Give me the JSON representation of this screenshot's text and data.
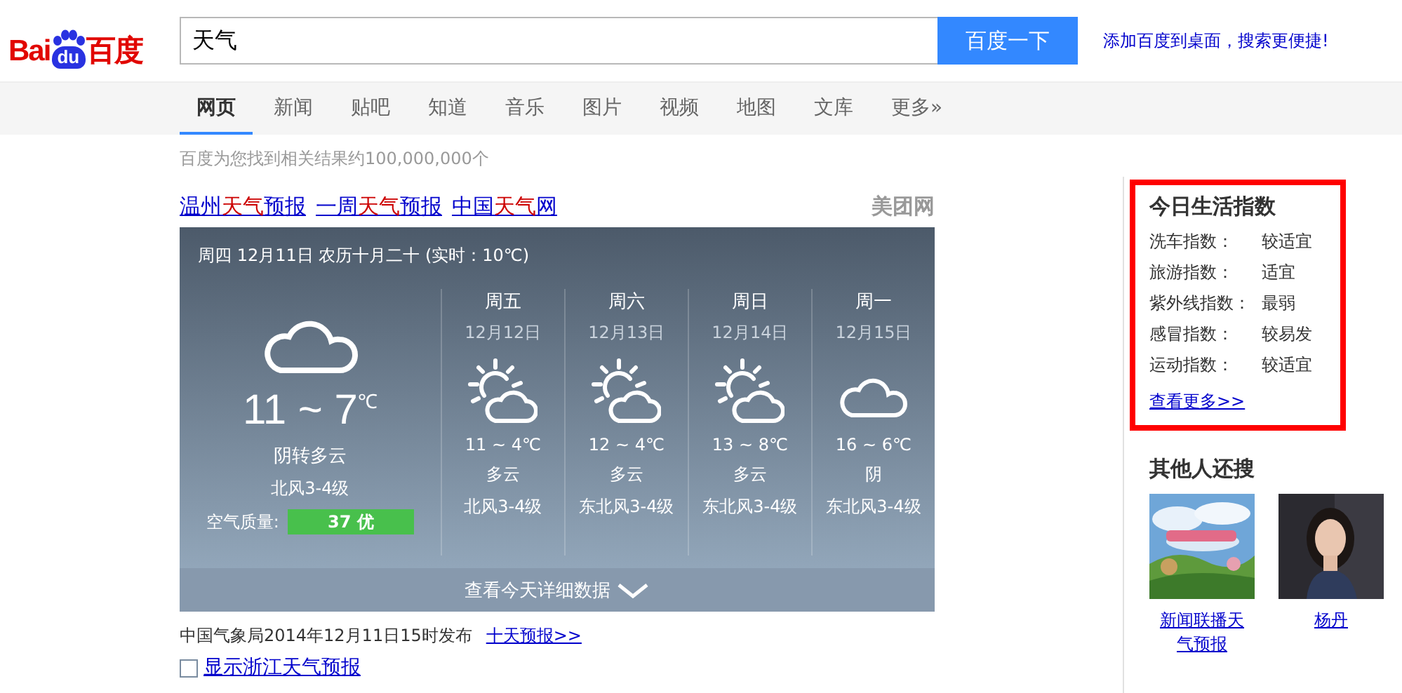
{
  "logo": {
    "left": "Bai",
    "mark": "du",
    "right": "百度"
  },
  "search": {
    "value": "天气",
    "button": "百度一下"
  },
  "promo_link": "添加百度到桌面，搜索更便捷!",
  "tabs": [
    {
      "label": "网页",
      "selected": true
    },
    {
      "label": "新闻",
      "selected": false
    },
    {
      "label": "贴吧",
      "selected": false
    },
    {
      "label": "知道",
      "selected": false
    },
    {
      "label": "音乐",
      "selected": false
    },
    {
      "label": "图片",
      "selected": false
    },
    {
      "label": "视频",
      "selected": false
    },
    {
      "label": "地图",
      "selected": false
    },
    {
      "label": "文库",
      "selected": false
    },
    {
      "label": "更多»",
      "selected": false
    }
  ],
  "result_count": "百度为您找到相关结果约100,000,000个",
  "result_title": [
    [
      {
        "text": "温州",
        "highlight": false
      },
      {
        "text": "天气",
        "highlight": true
      },
      {
        "text": "预报",
        "highlight": false
      }
    ],
    [
      {
        "text": "一周",
        "highlight": false
      },
      {
        "text": "天气",
        "highlight": true
      },
      {
        "text": "预报",
        "highlight": false
      }
    ],
    [
      {
        "text": "中国",
        "highlight": false
      },
      {
        "text": "天气",
        "highlight": true
      },
      {
        "text": "网",
        "highlight": false
      }
    ]
  ],
  "source_site": "美团网",
  "weather": {
    "header": "周四 12月11日 农历十月二十 (实时：10℃)",
    "today": {
      "kind": "cloudy",
      "temp": "11 ~ 7",
      "unit": "℃",
      "condition": "阴转多云",
      "wind": "北风3-4级",
      "air_label": "空气质量:",
      "air_value": "37 优"
    },
    "days": [
      {
        "day": "周五",
        "date": "12月12日",
        "kind": "partly_cloudy",
        "temp": "11 ~ 4℃",
        "condition": "多云",
        "wind": "北风3-4级"
      },
      {
        "day": "周六",
        "date": "12月13日",
        "kind": "partly_cloudy",
        "temp": "12 ~ 4℃",
        "condition": "多云",
        "wind": "东北风3-4级"
      },
      {
        "day": "周日",
        "date": "12月14日",
        "kind": "partly_cloudy",
        "temp": "13 ~ 8℃",
        "condition": "多云",
        "wind": "东北风3-4级"
      },
      {
        "day": "周一",
        "date": "12月15日",
        "kind": "cloudy",
        "temp": "16 ~ 6℃",
        "condition": "阴",
        "wind": "东北风3-4级"
      }
    ],
    "details_button": "查看今天详细数据"
  },
  "publish_note": "中国气象局2014年12月11日15时发布",
  "ten_day_link": "十天预报>>",
  "zhejiang_option": {
    "label": "显示浙江天气预报",
    "checked": false
  },
  "life_index": {
    "title": "今日生活指数",
    "rows": [
      {
        "label": "洗车指数：",
        "value": "较适宜"
      },
      {
        "label": "旅游指数：",
        "value": "适宜"
      },
      {
        "label": "紫外线指数：",
        "value": "最弱"
      },
      {
        "label": "感冒指数：",
        "value": "较易发"
      },
      {
        "label": "运动指数：",
        "value": "较适宜"
      }
    ],
    "more": "查看更多>>"
  },
  "related": {
    "title": "其他人还搜",
    "items": [
      {
        "kind": "picture",
        "caption": "新闻联播天气预报"
      },
      {
        "kind": "picture",
        "caption": "杨丹"
      }
    ]
  }
}
